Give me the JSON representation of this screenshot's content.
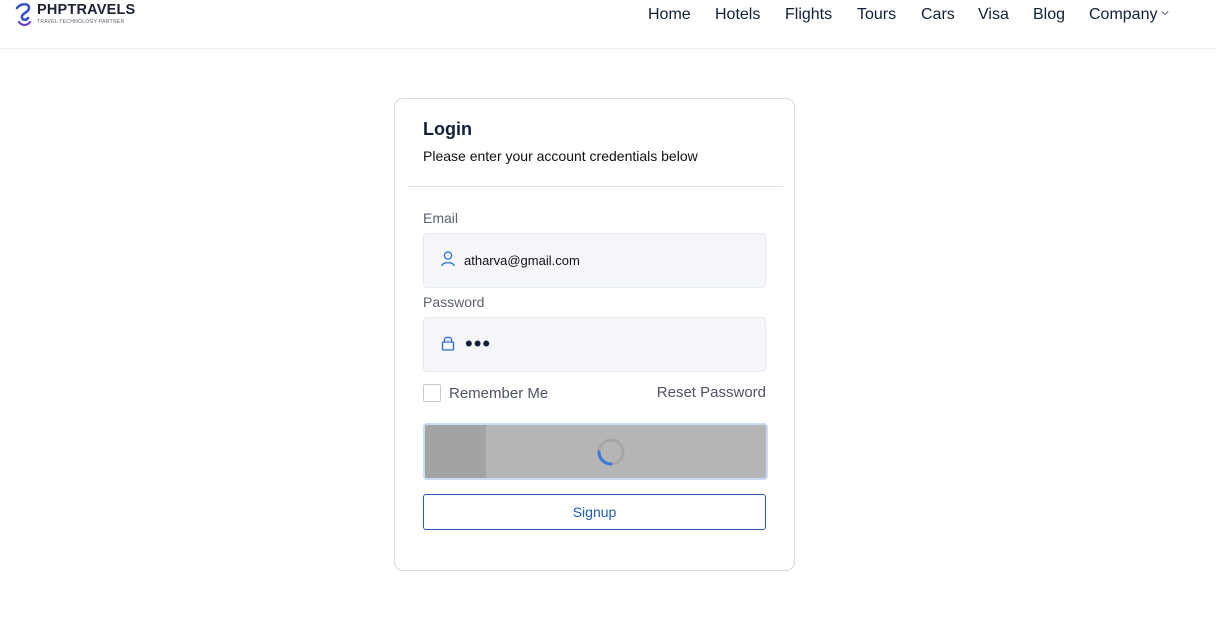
{
  "header": {
    "brand_name": "PHPTRAVELS",
    "brand_tagline": "TRAVEL TECHNOLOGY PARTNER",
    "nav": [
      {
        "label": "Home"
      },
      {
        "label": "Hotels"
      },
      {
        "label": "Flights"
      },
      {
        "label": "Tours"
      },
      {
        "label": "Cars"
      },
      {
        "label": "Visa"
      },
      {
        "label": "Blog"
      },
      {
        "label": "Company"
      }
    ]
  },
  "login": {
    "title": "Login",
    "subtitle": "Please enter your account credentials below",
    "email_label": "Email",
    "email_value": "atharva@gmail.com",
    "password_label": "Password",
    "password_mask": "•••",
    "remember_label": "Remember Me",
    "remember_checked": false,
    "reset_label": "Reset Password",
    "login_state": "loading",
    "signup_label": "Signup"
  },
  "colors": {
    "accent": "#1f5fb3",
    "icon_blue": "#2a6fd6",
    "loading_button": "#b5b5b5"
  },
  "icons": {
    "email_field": "user-icon",
    "password_field": "lock-icon",
    "company_dropdown": "chevron-down-icon",
    "login_button": "spinner-icon"
  }
}
